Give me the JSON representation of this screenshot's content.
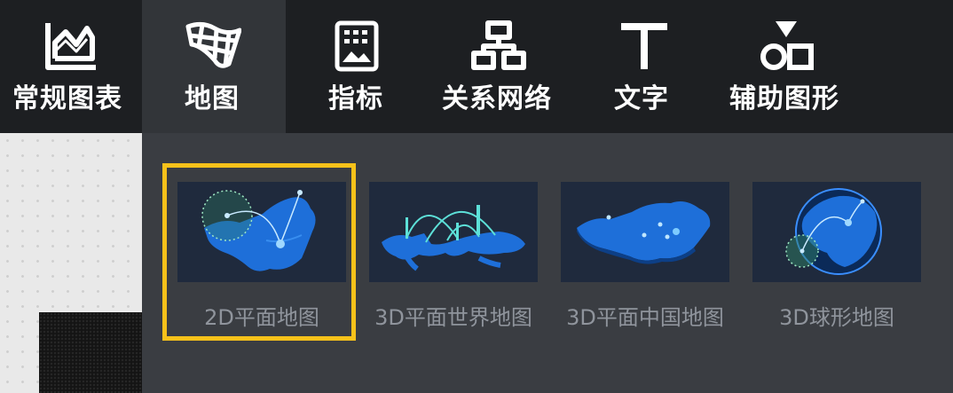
{
  "toolbar": {
    "items": [
      {
        "label": "常规图表",
        "icon": "area-chart-icon"
      },
      {
        "label": "地图",
        "icon": "map-grid-icon"
      },
      {
        "label": "指标",
        "icon": "indicator-icon"
      },
      {
        "label": "关系网络",
        "icon": "network-icon"
      },
      {
        "label": "文字",
        "icon": "text-icon"
      },
      {
        "label": "辅助图形",
        "icon": "shapes-icon"
      }
    ],
    "active_index": 1
  },
  "map_panel": {
    "cards": [
      {
        "caption": "2D平面地图",
        "selected": true
      },
      {
        "caption": "3D平面世界地图",
        "selected": false
      },
      {
        "caption": "3D平面中国地图",
        "selected": false
      },
      {
        "caption": "3D球形地图",
        "selected": false
      }
    ]
  },
  "colors": {
    "toolbar_bg": "#1d1f22",
    "active_tab_bg": "#323539",
    "panel_bg": "#3a3d42",
    "selection": "#f7c21a",
    "map_blue": "#1e6fd9"
  }
}
